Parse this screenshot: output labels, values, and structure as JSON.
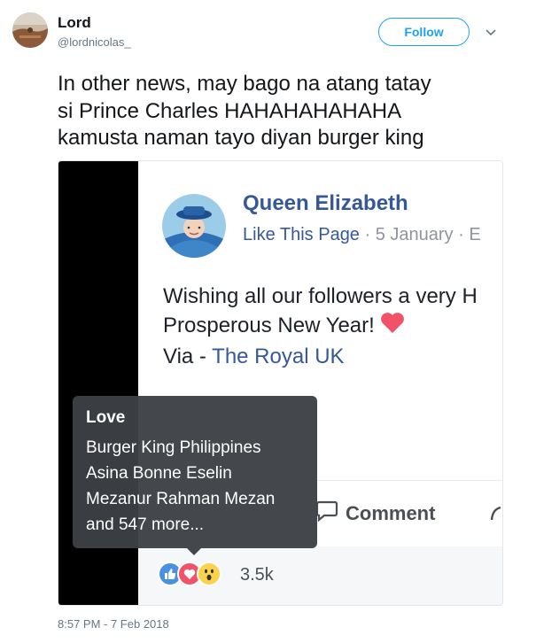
{
  "tweet": {
    "display_name": "Lord",
    "handle": "@lordnicolas_",
    "follow_label": "Follow",
    "text_lines": [
      "In other news, may bago na atang tatay",
      "si Prince Charles HAHAHAHAHAHA",
      "kamusta naman tayo diyan burger king"
    ],
    "timestamp": "8:57 PM - 7 Feb 2018"
  },
  "post": {
    "page_name": "Queen Elizabeth",
    "like_page": "Like This Page",
    "sep1": " · ",
    "date": "5 January",
    "sep2": " · E",
    "line1": "Wishing all our followers a very H",
    "line2": "Prosperous New Year!",
    "via_prefix": "Via - ",
    "via_link": "The Royal UK",
    "comment_label": "Comment",
    "reactions_count": "3.5k"
  },
  "tooltip": {
    "title": "Love",
    "names": [
      "Burger King Philippines",
      "Asina Bonne Eselin",
      "Mezanur Rahman Mezan",
      "and 547 more..."
    ]
  },
  "colors": {
    "twitter_blue": "#1da1f2",
    "fb_blue": "#365899",
    "love_red": "#f25268"
  },
  "icons": {
    "caret": "chevron-down-icon",
    "comment": "comment-icon",
    "like_reaction": "like-reaction-icon",
    "love_reaction": "love-reaction-icon",
    "wow_reaction": "wow-reaction-icon"
  }
}
